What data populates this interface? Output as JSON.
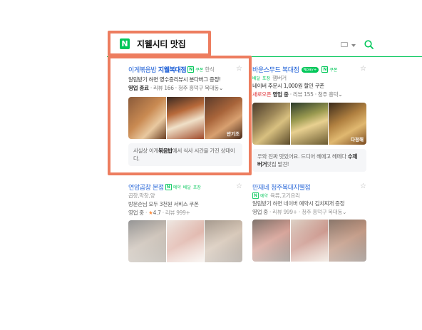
{
  "search": {
    "query": "지웰시티 맛집",
    "logo": "N"
  },
  "cards": [
    {
      "name_a": "이게볶음밥",
      "name_b": "지웰복대점",
      "coupon": "쿠폰",
      "category": "한식",
      "line2": "알림받기 하면 영수증리뷰시 분다버그 증정!",
      "status": "영업 종료",
      "sep": "·",
      "reviews": "리뷰 166",
      "location": "청주 흥덕구 복대동",
      "photo_label": "반기조",
      "blurb_a": "사실상 이게",
      "blurb_b": "볶음밥",
      "blurb_c": "에서 식사 시간을 가진 상태이다."
    },
    {
      "name": "바운스무드 복대점",
      "pay": "Npay+",
      "coupon": "쿠폰",
      "delivery": "배달",
      "takeout": "포장",
      "category": "햄버거",
      "line2": "네이버 주문시 1,000원 할인 쿠폰",
      "new_open": "새로오픈",
      "status": "영업 중",
      "reviews": "리뷰 155",
      "location": "청주 흥덕",
      "photo_label": "다정해",
      "blurb_a": "우와 진짜 맛있어요. 드디어 헤에고 헤메다 ",
      "blurb_b": "수제버거",
      "blurb_c": "맛집 발견!"
    },
    {
      "name": "연암곱창 본점",
      "reserve": "예약",
      "delivery": "배달",
      "takeout": "포장",
      "category": "곱창,막창,양",
      "line2": "방문손님 모두 3천원 서비스 쿠폰",
      "status": "영업 중",
      "rating": "4.7",
      "reviews": "리뷰 999+"
    },
    {
      "name": "만재네 청주복대지웰점",
      "reserve": "예약",
      "category": "육류,고기요리",
      "line2": "알림받기 하면 네이버 예약시 김치찌개 증정",
      "status": "영업 중",
      "reviews": "리뷰 999+",
      "location": "청주 흥덕구 복대동"
    }
  ],
  "colors": {
    "accent": "#03c75a",
    "link": "#1d5fd6",
    "highlight": "#ed7d5f"
  }
}
